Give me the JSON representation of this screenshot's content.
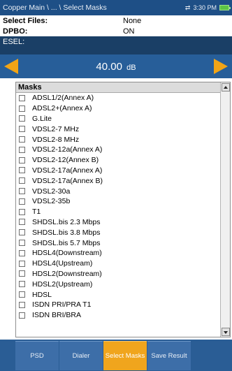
{
  "titlebar": {
    "path": "Copper Main \\ ... \\ Select Masks",
    "time": "3:30 PM",
    "icons": [
      "transfer-arrows-icon",
      "battery-icon"
    ]
  },
  "info": {
    "select_files_label": "Select Files:",
    "select_files_value": "None",
    "dpbo_label": "DPBO:",
    "dpbo_value": "ON"
  },
  "esel": {
    "label": "ESEL:",
    "value": "40.00",
    "unit": "dB"
  },
  "masks": {
    "header": "Masks",
    "items": [
      {
        "label": "ADSL1/2(Annex A)",
        "checked": false
      },
      {
        "label": "ADSL2+(Annex A)",
        "checked": false
      },
      {
        "label": "G.Lite",
        "checked": false
      },
      {
        "label": "VDSL2-7 MHz",
        "checked": false
      },
      {
        "label": "VDSL2-8 MHz",
        "checked": false
      },
      {
        "label": "VDSL2-12a(Annex A)",
        "checked": false
      },
      {
        "label": "VDSL2-12(Annex B)",
        "checked": false
      },
      {
        "label": "VDSL2-17a(Annex A)",
        "checked": false
      },
      {
        "label": "VDSL2-17a(Annex B)",
        "checked": false
      },
      {
        "label": "VDSL2-30a",
        "checked": false
      },
      {
        "label": "VDSL2-35b",
        "checked": false
      },
      {
        "label": "T1",
        "checked": false
      },
      {
        "label": "SHDSL.bis 2.3 Mbps",
        "checked": false
      },
      {
        "label": "SHDSL.bis 3.8 Mbps",
        "checked": false
      },
      {
        "label": "SHDSL.bis 5.7 Mbps",
        "checked": false
      },
      {
        "label": "HDSL4(Downstream)",
        "checked": false
      },
      {
        "label": "HDSL4(Upstream)",
        "checked": false
      },
      {
        "label": "HDSL2(Downstream)",
        "checked": false
      },
      {
        "label": "HDSL2(Upstream)",
        "checked": false
      },
      {
        "label": "HDSL",
        "checked": false
      },
      {
        "label": "ISDN PRI/PRA T1",
        "checked": false
      },
      {
        "label": "ISDN BRI/BRA",
        "checked": false
      }
    ]
  },
  "softkeys": [
    {
      "label": "PSD",
      "active": false
    },
    {
      "label": "Dialer",
      "active": false
    },
    {
      "label": "Select Masks",
      "active": true
    },
    {
      "label": "Save Result",
      "active": false
    }
  ],
  "colors": {
    "title_bg": "#1e4f86",
    "esel_bg": "#275e99",
    "accent": "#f1a416",
    "softkey_bg": "#3d6ea8"
  }
}
